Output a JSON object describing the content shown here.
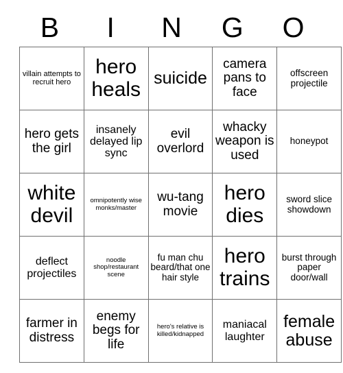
{
  "card": {
    "header_letters": [
      "B",
      "I",
      "N",
      "G",
      "O"
    ],
    "border_color": "#6f6f6f",
    "text_color": "#000000",
    "background_color": "#ffffff",
    "rows": [
      [
        {
          "text": "villain attempts to recruit hero",
          "size": "s"
        },
        {
          "text": "hero heals",
          "size": "huge"
        },
        {
          "text": "suicide",
          "size": "xxl"
        },
        {
          "text": "camera pans to face",
          "size": "xl"
        },
        {
          "text": "offscreen projectile",
          "size": "m"
        }
      ],
      [
        {
          "text": "hero gets the girl",
          "size": "xl"
        },
        {
          "text": "insanely delayed lip sync",
          "size": "l"
        },
        {
          "text": "evil overlord",
          "size": "xl"
        },
        {
          "text": "whacky weapon is used",
          "size": "xl"
        },
        {
          "text": "honeypot",
          "size": "m"
        }
      ],
      [
        {
          "text": "white devil",
          "size": "huge"
        },
        {
          "text": "omnipotently wise monks/master",
          "size": "xs"
        },
        {
          "text": "wu-tang movie",
          "size": "xl"
        },
        {
          "text": "hero dies",
          "size": "huge"
        },
        {
          "text": "sword slice showdown",
          "size": "m"
        }
      ],
      [
        {
          "text": "deflect projectiles",
          "size": "l"
        },
        {
          "text": "noodle shop/restaurant scene",
          "size": "xs"
        },
        {
          "text": "fu man chu beard/that one hair style",
          "size": "m"
        },
        {
          "text": "hero trains",
          "size": "huge"
        },
        {
          "text": "burst through paper door/wall",
          "size": "m"
        }
      ],
      [
        {
          "text": "farmer in distress",
          "size": "xl"
        },
        {
          "text": "enemy begs for life",
          "size": "xl"
        },
        {
          "text": "hero's relative is killed/kidnapped",
          "size": "xs"
        },
        {
          "text": "maniacal laughter",
          "size": "l"
        },
        {
          "text": "female abuse",
          "size": "xxl"
        }
      ]
    ]
  }
}
